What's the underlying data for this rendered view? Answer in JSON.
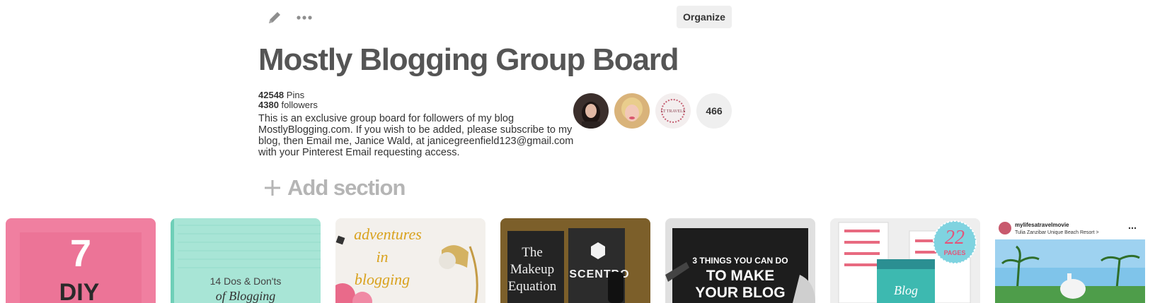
{
  "toolbar": {
    "edit_icon": "pencil-icon",
    "more_icon": "ellipsis-icon",
    "organize_label": "Organize"
  },
  "board": {
    "title": "Mostly Blogging Group Board",
    "pins_count": "42548",
    "pins_label": "Pins",
    "followers_count": "4380",
    "followers_label": "followers",
    "description": "This is an exclusive group board for followers of my blog MostlyBlogging.com. If you wish to be added, please subscribe to my blog, then Email me, Janice Wald, at janicegreenfield123@gmail.com with your Pinterest Email requesting access."
  },
  "collaborators": {
    "more_count": "466",
    "logo_text": "LT TRAVELS"
  },
  "add_section": {
    "label": "Add section",
    "icon": "plus-icon"
  },
  "pins": [
    {
      "bg": "#f07fa0",
      "line1": "7",
      "line2": "DIY"
    },
    {
      "bg": "#a8e5d6",
      "line1": "14 Dos & Don'ts",
      "line2": "of Blogging"
    },
    {
      "bg": "#f3f0ec",
      "line1": "adventures",
      "line2": "in",
      "line3": "blogging"
    },
    {
      "bg": "#2b2a28",
      "line1": "The",
      "line2": "Makeup",
      "line3": "Equation",
      "brand": "SCENTBO"
    },
    {
      "bg": "#1d1d1d",
      "line1": "3 THINGS YOU CAN DO",
      "line2": "TO MAKE",
      "line3": "YOUR BLOG"
    },
    {
      "bg": "#eeeeee",
      "badge_num": "22",
      "badge_text": "PAGES",
      "book": "Blog"
    },
    {
      "bg": "#ffffff",
      "account": "mylifesatravelmovie",
      "location": "Tulia Zanzibar Unique Beach Resort >"
    }
  ]
}
